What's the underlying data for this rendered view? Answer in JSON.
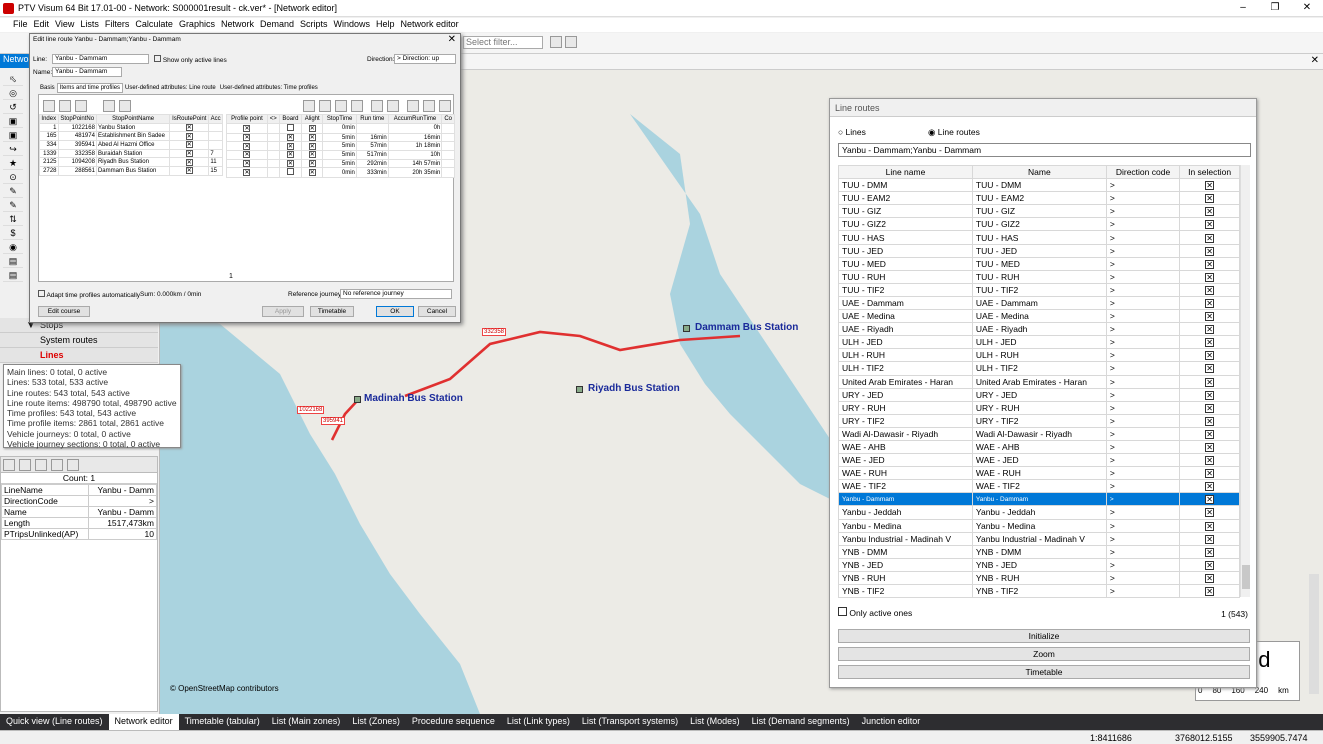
{
  "app": {
    "title": "PTV Visum 64 Bit 17.01-00 - Network: S000001result - ck.ver* - [Network editor]"
  },
  "menu": [
    "File",
    "Edit",
    "View",
    "Lists",
    "Filters",
    "Calculate",
    "Graphics",
    "Network",
    "Demand",
    "Scripts",
    "Windows",
    "Help",
    "Network editor"
  ],
  "toolbar": {
    "filter_placeholder": "Select filter..."
  },
  "left": {
    "tab": "Netwo",
    "items": [
      "Stops",
      "System routes",
      "Lines"
    ]
  },
  "tooltip": [
    "Main lines: 0 total, 0 active",
    "Lines: 533 total, 533 active",
    "Line routes: 543 total, 543 active",
    "Line route items: 498790 total, 498790 active",
    "Time profiles: 543 total, 543 active",
    "Time profile items: 2861 total, 2861 active",
    "Vehicle journeys: 0 total, 0 active",
    "Vehicle journey sections: 0 total, 0 active"
  ],
  "quickview": {
    "count": "Count: 1",
    "rows": [
      [
        "LineName",
        "Yanbu - Damm"
      ],
      [
        "DirectionCode",
        ">"
      ],
      [
        "Name",
        "Yanbu - Damm"
      ],
      [
        "Length",
        "1517,473km"
      ],
      [
        "PTripsUnlinked(AP)",
        "10"
      ]
    ]
  },
  "dialog": {
    "title": "Edit line route Yanbu - Dammam;Yanbu - Dammam",
    "line_label": "Line:",
    "line_value": "Yanbu - Dammam",
    "only_active": "Show only active lines",
    "direction_label": "Direction:",
    "direction_value": "> Direction: up",
    "name_label": "Name:",
    "name_value": "Yanbu - Dammam",
    "tabs": [
      "Basis",
      "Items and time profiles",
      "User-defined attributes: Line route",
      "User-defined attributes: Time profiles"
    ],
    "left_headers": [
      "Index",
      "StopPointNo",
      "StopPointName",
      "IsRoutePoint",
      "Acc"
    ],
    "left_rows": [
      [
        "1",
        "1022168",
        "Yanbu Station",
        "x",
        ""
      ],
      [
        "165",
        "481974",
        "Establishment Bin Sadee",
        "x",
        ""
      ],
      [
        "334",
        "395941",
        "Abed Al Hazmi Office",
        "x",
        ""
      ],
      [
        "1339",
        "332358",
        "Buraidah Station",
        "x",
        "7"
      ],
      [
        "2125",
        "1094208",
        "Riyadh Bus Station",
        "x",
        "11"
      ],
      [
        "2728",
        "288561",
        "Dammam Bus Station",
        "x",
        "15"
      ]
    ],
    "right_headers": [
      "Profile point",
      "<>",
      "Board",
      "Alight",
      "StopTime",
      "Run time",
      "AccumRunTime",
      "Co"
    ],
    "right_rows": [
      [
        "x",
        "",
        "",
        "x",
        "0min",
        "",
        "0h"
      ],
      [
        "x",
        "",
        "x",
        "x",
        "5min",
        "16min",
        "16min"
      ],
      [
        "x",
        "",
        "x",
        "x",
        "5min",
        "57min",
        "1h 18min"
      ],
      [
        "x",
        "",
        "x",
        "x",
        "5min",
        "517min",
        "10h"
      ],
      [
        "x",
        "",
        "x",
        "x",
        "5min",
        "292min",
        "14h 57min"
      ],
      [
        "x",
        "",
        "",
        "x",
        "0min",
        "333min",
        "20h 35min"
      ]
    ],
    "page": "1",
    "adapt": "Adapt time profiles automatically",
    "sum": "Sum: 0.000km / 0min",
    "ref_label": "Reference journey:",
    "ref_value": "No reference journey",
    "edit_course": "Edit course",
    "apply": "Apply",
    "timetable": "Timetable",
    "ok": "OK",
    "cancel": "Cancel"
  },
  "map": {
    "credit": "© OpenStreetMap contributors",
    "stations": [
      "Madinah Bus Station",
      "Riyadh Bus Station",
      "Dammam Bus Station"
    ],
    "route_labels": [
      "1022168",
      "395941",
      "332358"
    ],
    "legend_text": "nd",
    "scale": [
      "0",
      "80",
      "160",
      "240",
      "km"
    ]
  },
  "lineroutes": {
    "title": "Line routes",
    "opt_lines": "Lines",
    "opt_lineroutes": "Line routes",
    "search": "Yanbu - Dammam;Yanbu - Dammam",
    "headers": [
      "Line name",
      "Name",
      "Direction code",
      "In selection"
    ],
    "rows": [
      [
        "TUU - DMM",
        "TUU - DMM",
        ">"
      ],
      [
        "TUU - EAM2",
        "TUU - EAM2",
        ">"
      ],
      [
        "TUU - GIZ",
        "TUU - GIZ",
        ">"
      ],
      [
        "TUU - GIZ2",
        "TUU - GIZ2",
        ">"
      ],
      [
        "TUU - HAS",
        "TUU - HAS",
        ">"
      ],
      [
        "TUU - JED",
        "TUU - JED",
        ">"
      ],
      [
        "TUU - MED",
        "TUU - MED",
        ">"
      ],
      [
        "TUU - RUH",
        "TUU - RUH",
        ">"
      ],
      [
        "TUU - TIF2",
        "TUU - TIF2",
        ">"
      ],
      [
        "UAE - Dammam",
        "UAE - Dammam",
        ">"
      ],
      [
        "UAE - Medina",
        "UAE - Medina",
        ">"
      ],
      [
        "UAE - Riyadh",
        "UAE - Riyadh",
        ">"
      ],
      [
        "ULH - JED",
        "ULH - JED",
        ">"
      ],
      [
        "ULH - RUH",
        "ULH - RUH",
        ">"
      ],
      [
        "ULH - TIF2",
        "ULH - TIF2",
        ">"
      ],
      [
        "United Arab Emirates - Haran",
        "United Arab Emirates - Haran",
        ">"
      ],
      [
        "URY - JED",
        "URY - JED",
        ">"
      ],
      [
        "URY - RUH",
        "URY - RUH",
        ">"
      ],
      [
        "URY - TIF2",
        "URY - TIF2",
        ">"
      ],
      [
        "Wadi Al-Dawasir - Riyadh",
        "Wadi Al-Dawasir - Riyadh",
        ">"
      ],
      [
        "WAE - AHB",
        "WAE - AHB",
        ">"
      ],
      [
        "WAE - JED",
        "WAE - JED",
        ">"
      ],
      [
        "WAE - RUH",
        "WAE - RUH",
        ">"
      ],
      [
        "WAE - TIF2",
        "WAE - TIF2",
        ">"
      ],
      [
        "Yanbu - Dammam",
        "Yanbu - Dammam",
        ">"
      ],
      [
        "Yanbu - Jeddah",
        "Yanbu - Jeddah",
        ">"
      ],
      [
        "Yanbu - Medina",
        "Yanbu - Medina",
        ">"
      ],
      [
        "Yanbu Industrial - Madinah V",
        "Yanbu Industrial - Madinah V",
        ">"
      ],
      [
        "YNB - DMM",
        "YNB - DMM",
        ">"
      ],
      [
        "YNB - JED",
        "YNB - JED",
        ">"
      ],
      [
        "YNB - RUH",
        "YNB - RUH",
        ">"
      ],
      [
        "YNB - TIF2",
        "YNB - TIF2",
        ">"
      ]
    ],
    "selected_index": 24,
    "only_active": "Only active ones",
    "count": "1 (543)",
    "initialize": "Initialize",
    "zoom": "Zoom",
    "timetable": "Timetable"
  },
  "tabs": [
    "Quick view (Line routes)",
    "Network editor",
    "Timetable (tabular)",
    "List (Main zones)",
    "List (Zones)",
    "Procedure sequence",
    "List (Link types)",
    "List (Transport systems)",
    "List (Modes)",
    "List (Demand segments)",
    "Junction editor"
  ],
  "status": [
    "1:8411686",
    "3768012.5155",
    "3559905.7474"
  ]
}
